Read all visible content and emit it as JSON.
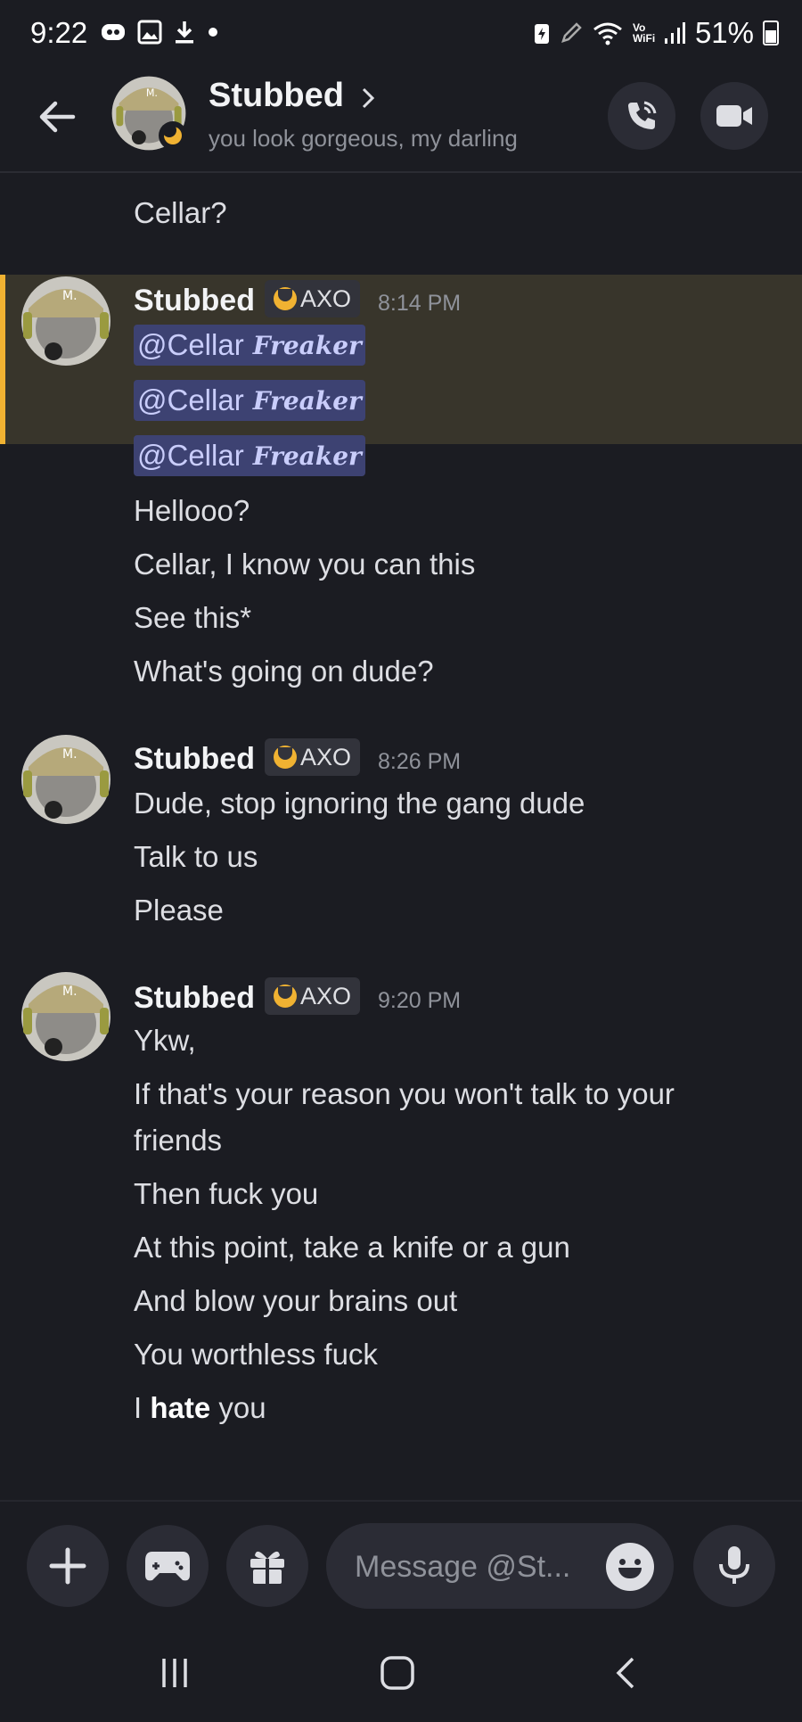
{
  "status_bar": {
    "time": "9:22",
    "battery": "51%",
    "wifi_label": "Vo WiFi"
  },
  "header": {
    "name": "Stubbed",
    "status": "you look gorgeous, my darling"
  },
  "messages": {
    "clipped_previous": "Cellar?",
    "groups": [
      {
        "author": "Stubbed",
        "tag": "AXO",
        "time": "8:14 PM",
        "mentions": [
          "@Cellar",
          "@Cellar",
          "@Cellar"
        ],
        "mention_fancy": "Freaker",
        "lines": [
          "Hellooo?",
          "Cellar, I know you can this",
          "See this*",
          "What's going on dude?"
        ]
      },
      {
        "author": "Stubbed",
        "tag": "AXO",
        "time": "8:26 PM",
        "lines": [
          "Dude, stop ignoring the gang dude",
          "Talk to us",
          "Please"
        ]
      },
      {
        "author": "Stubbed",
        "tag": "AXO",
        "time": "9:20 PM",
        "lines": [
          "Ykw,",
          "If that's your reason you won't talk to your",
          "friends",
          "Then fuck you",
          "At this point, take a knife or a gun",
          "And blow your brains out",
          "You worthless fuck"
        ],
        "last_line_prefix": "I ",
        "last_line_bold": "hate",
        "last_line_suffix": " you"
      }
    ]
  },
  "composer": {
    "placeholder": "Message @St..."
  },
  "colors": {
    "background": "#1b1c22",
    "highlight": "#38352b",
    "highlight_bar": "#f0b232",
    "mention_bg": "#3d4272",
    "mention_text": "#c9cdfb"
  }
}
